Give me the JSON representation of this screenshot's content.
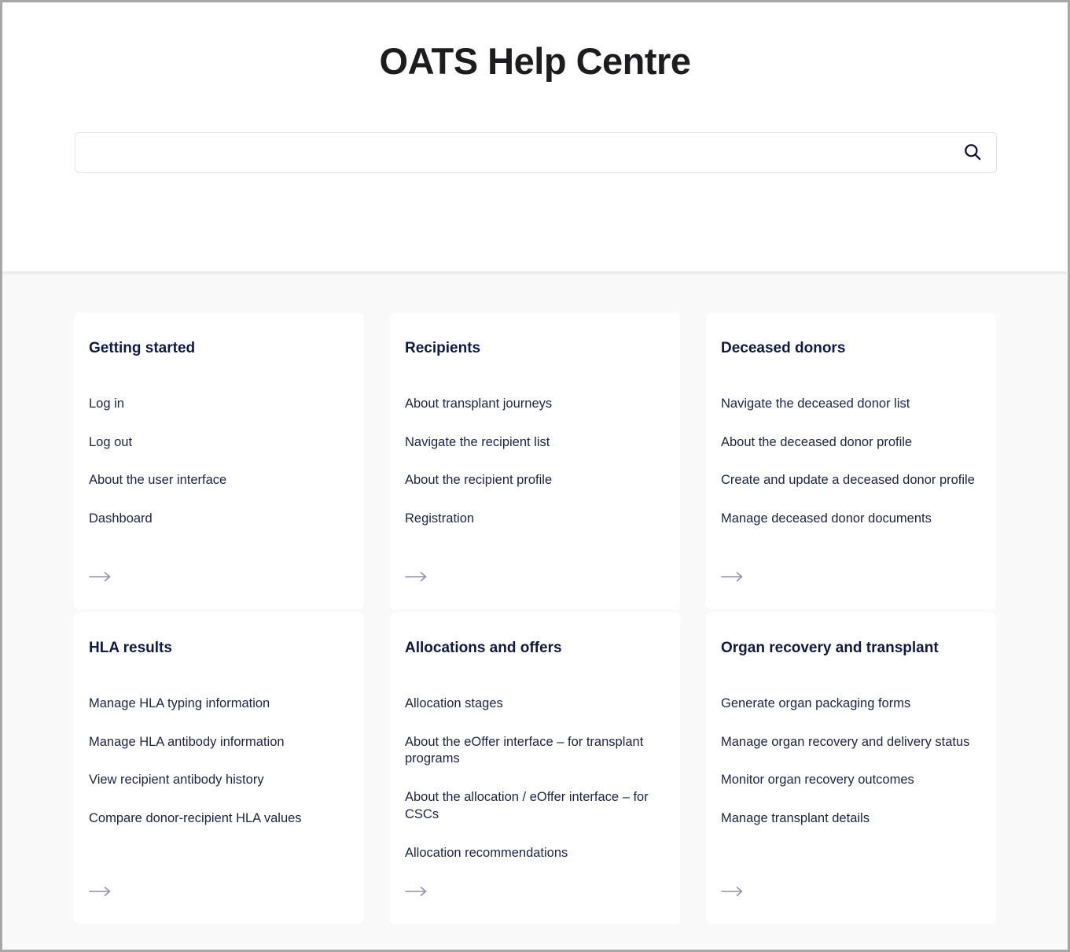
{
  "header": {
    "title": "OATS Help Centre",
    "search": {
      "value": "",
      "placeholder": "",
      "icon": "search-icon"
    }
  },
  "theme": {
    "page_background": "#ffffff",
    "body_background": "#f9f9f9",
    "card_background": "#ffffff",
    "heading_color": "#0f1941",
    "link_color": "#1b2444",
    "arrow_color": "#8b93a8",
    "frame_border": "#a7a7a7",
    "search_border": "#e3e3e6"
  },
  "cards": [
    {
      "title": "Getting started",
      "links": [
        "Log in",
        "Log out",
        "About the user interface",
        "Dashboard"
      ],
      "more_icon": "arrow-right-icon"
    },
    {
      "title": "Recipients",
      "links": [
        "About transplant journeys",
        "Navigate the recipient list",
        "About the recipient profile",
        "Registration"
      ],
      "more_icon": "arrow-right-icon"
    },
    {
      "title": "Deceased donors",
      "links": [
        "Navigate the deceased donor list",
        "About the deceased donor profile",
        "Create and update a deceased donor profile",
        "Manage deceased donor documents"
      ],
      "more_icon": "arrow-right-icon"
    },
    {
      "title": "HLA results",
      "links": [
        "Manage HLA typing information",
        "Manage HLA antibody information",
        "View recipient antibody history",
        "Compare donor-recipient HLA values"
      ],
      "more_icon": "arrow-right-icon"
    },
    {
      "title": "Allocations and offers",
      "links": [
        "Allocation stages",
        "About the eOffer interface – for transplant programs",
        "About the allocation / eOffer interface – for CSCs",
        "Allocation recommendations"
      ],
      "more_icon": "arrow-right-icon"
    },
    {
      "title": "Organ recovery and transplant",
      "links": [
        "Generate organ packaging forms",
        "Manage organ recovery and delivery status",
        "Monitor organ recovery outcomes",
        "Manage transplant details"
      ],
      "more_icon": "arrow-right-icon"
    }
  ]
}
